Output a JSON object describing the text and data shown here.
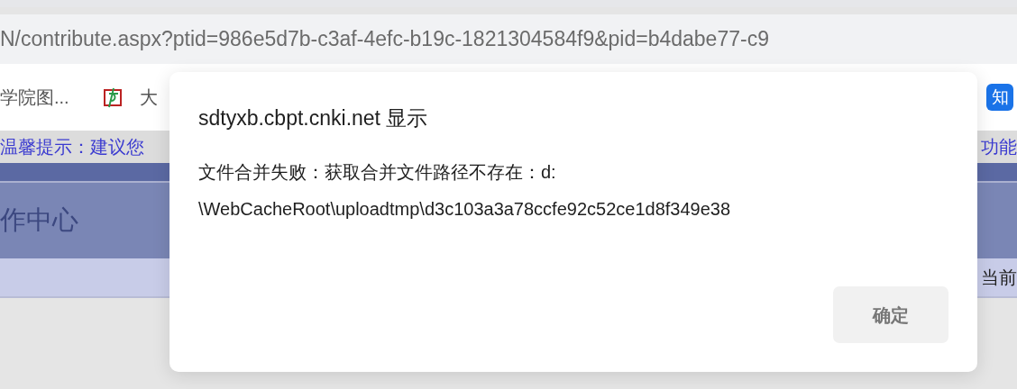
{
  "address_bar": {
    "url": "N/contribute.aspx?ptid=986e5d7b-c3af-4efc-b19c-1821304584f9&pid=b4dabe77-c9"
  },
  "bookmarks": [
    {
      "label": "学院图...",
      "kind": "text"
    },
    {
      "label": "大",
      "kind": "icon"
    }
  ],
  "bookmark_right": {
    "glyph": "知"
  },
  "notice": {
    "left": "温馨提示：建议您",
    "right": "功能"
  },
  "header": {
    "title": "作中心"
  },
  "breadcrumb": {
    "right": "当前"
  },
  "dialog": {
    "title": "sdtyxb.cbpt.cnki.net 显示",
    "message_lines": [
      "文件合并失败：获取合并文件路径不存在：d:",
      "\\WebCacheRoot\\uploadtmp\\d3c103a3a78ccfe92c52ce1d8f349e38"
    ],
    "button": "确定"
  }
}
